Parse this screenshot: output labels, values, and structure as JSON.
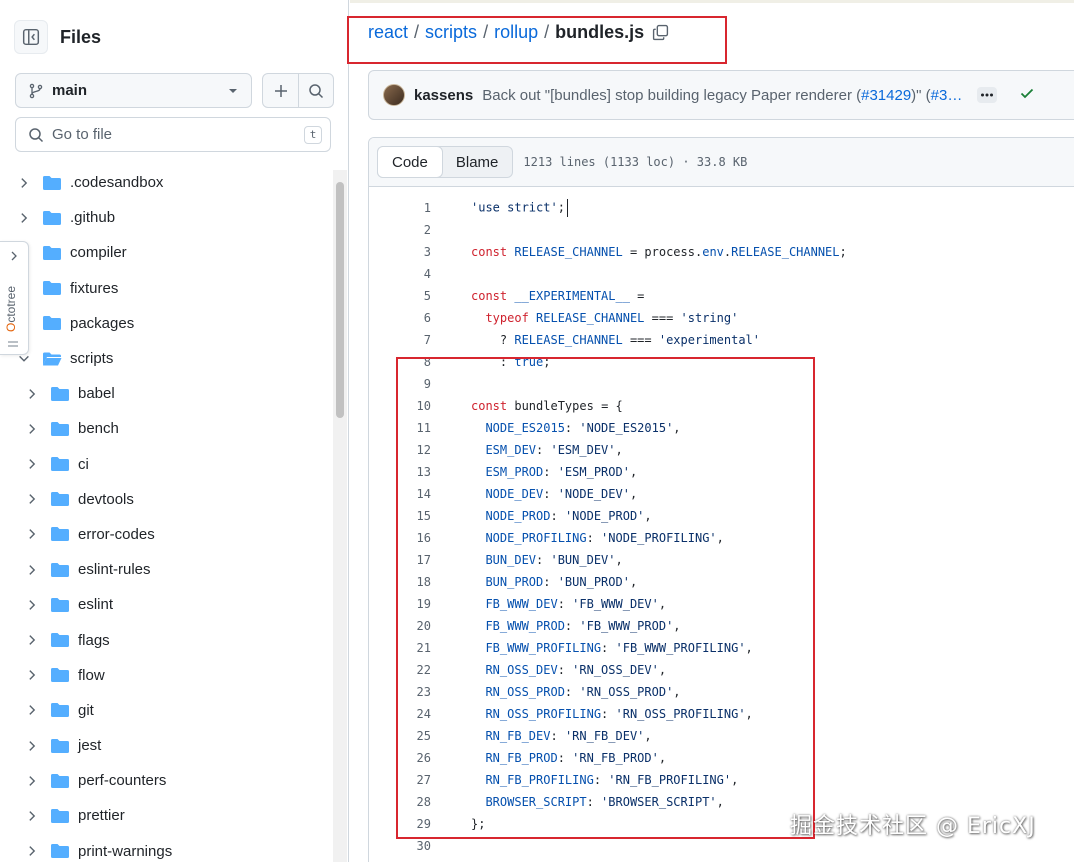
{
  "sidebar": {
    "title": "Files",
    "branch": "main",
    "goto_placeholder": "Go to file",
    "goto_shortcut": "t",
    "octotree_label": "Octotree",
    "tree": [
      {
        "name": ".codesandbox",
        "level": 0,
        "open": false
      },
      {
        "name": ".github",
        "level": 0,
        "open": false
      },
      {
        "name": "compiler",
        "level": 0,
        "open": false
      },
      {
        "name": "fixtures",
        "level": 0,
        "open": false
      },
      {
        "name": "packages",
        "level": 0,
        "open": false
      },
      {
        "name": "scripts",
        "level": 0,
        "open": true
      },
      {
        "name": "babel",
        "level": 1,
        "open": false
      },
      {
        "name": "bench",
        "level": 1,
        "open": false
      },
      {
        "name": "ci",
        "level": 1,
        "open": false
      },
      {
        "name": "devtools",
        "level": 1,
        "open": false
      },
      {
        "name": "error-codes",
        "level": 1,
        "open": false
      },
      {
        "name": "eslint-rules",
        "level": 1,
        "open": false
      },
      {
        "name": "eslint",
        "level": 1,
        "open": false
      },
      {
        "name": "flags",
        "level": 1,
        "open": false
      },
      {
        "name": "flow",
        "level": 1,
        "open": false
      },
      {
        "name": "git",
        "level": 1,
        "open": false
      },
      {
        "name": "jest",
        "level": 1,
        "open": false
      },
      {
        "name": "perf-counters",
        "level": 1,
        "open": false
      },
      {
        "name": "prettier",
        "level": 1,
        "open": false
      },
      {
        "name": "print-warnings",
        "level": 1,
        "open": false
      }
    ]
  },
  "breadcrumb": {
    "parts": [
      "react",
      "scripts",
      "rollup"
    ],
    "file": "bundles.js",
    "separator": "/"
  },
  "commit": {
    "author": "kassens",
    "message_prefix": "Back out \"[bundles] stop building legacy Paper renderer (",
    "pr_link": "#31429",
    "message_suffix": ")\" (",
    "trailing_link": "#3…"
  },
  "code_view": {
    "tabs": [
      "Code",
      "Blame"
    ],
    "active_tab": "Code",
    "file_info": "1213 lines (1133 loc) · 33.8 KB"
  },
  "code_lines": [
    [
      {
        "t": "'use strict'",
        "c": "str"
      },
      {
        "t": ";",
        "c": "plain"
      }
    ],
    [],
    [
      {
        "t": "const ",
        "c": "kw"
      },
      {
        "t": "RELEASE_CHANNEL",
        "c": "id"
      },
      {
        "t": " = process.",
        "c": "plain"
      },
      {
        "t": "env",
        "c": "id"
      },
      {
        "t": ".",
        "c": "plain"
      },
      {
        "t": "RELEASE_CHANNEL",
        "c": "id"
      },
      {
        "t": ";",
        "c": "plain"
      }
    ],
    [],
    [
      {
        "t": "const ",
        "c": "kw"
      },
      {
        "t": "__EXPERIMENTAL__",
        "c": "id"
      },
      {
        "t": " =",
        "c": "plain"
      }
    ],
    [
      {
        "t": "  typeof ",
        "c": "kw"
      },
      {
        "t": "RELEASE_CHANNEL",
        "c": "id"
      },
      {
        "t": " === ",
        "c": "plain"
      },
      {
        "t": "'string'",
        "c": "str"
      }
    ],
    [
      {
        "t": "    ? ",
        "c": "plain"
      },
      {
        "t": "RELEASE_CHANNEL",
        "c": "id"
      },
      {
        "t": " === ",
        "c": "plain"
      },
      {
        "t": "'experimental'",
        "c": "str"
      }
    ],
    [
      {
        "t": "    : ",
        "c": "plain"
      },
      {
        "t": "true",
        "c": "id"
      },
      {
        "t": ";",
        "c": "plain"
      }
    ],
    [],
    [
      {
        "t": "const ",
        "c": "kw"
      },
      {
        "t": "bundleTypes",
        "c": "plain"
      },
      {
        "t": " = {",
        "c": "plain"
      }
    ],
    [
      {
        "t": "  NODE_ES2015",
        "c": "id"
      },
      {
        "t": ": ",
        "c": "plain"
      },
      {
        "t": "'NODE_ES2015'",
        "c": "str"
      },
      {
        "t": ",",
        "c": "plain"
      }
    ],
    [
      {
        "t": "  ESM_DEV",
        "c": "id"
      },
      {
        "t": ": ",
        "c": "plain"
      },
      {
        "t": "'ESM_DEV'",
        "c": "str"
      },
      {
        "t": ",",
        "c": "plain"
      }
    ],
    [
      {
        "t": "  ESM_PROD",
        "c": "id"
      },
      {
        "t": ": ",
        "c": "plain"
      },
      {
        "t": "'ESM_PROD'",
        "c": "str"
      },
      {
        "t": ",",
        "c": "plain"
      }
    ],
    [
      {
        "t": "  NODE_DEV",
        "c": "id"
      },
      {
        "t": ": ",
        "c": "plain"
      },
      {
        "t": "'NODE_DEV'",
        "c": "str"
      },
      {
        "t": ",",
        "c": "plain"
      }
    ],
    [
      {
        "t": "  NODE_PROD",
        "c": "id"
      },
      {
        "t": ": ",
        "c": "plain"
      },
      {
        "t": "'NODE_PROD'",
        "c": "str"
      },
      {
        "t": ",",
        "c": "plain"
      }
    ],
    [
      {
        "t": "  NODE_PROFILING",
        "c": "id"
      },
      {
        "t": ": ",
        "c": "plain"
      },
      {
        "t": "'NODE_PROFILING'",
        "c": "str"
      },
      {
        "t": ",",
        "c": "plain"
      }
    ],
    [
      {
        "t": "  BUN_DEV",
        "c": "id"
      },
      {
        "t": ": ",
        "c": "plain"
      },
      {
        "t": "'BUN_DEV'",
        "c": "str"
      },
      {
        "t": ",",
        "c": "plain"
      }
    ],
    [
      {
        "t": "  BUN_PROD",
        "c": "id"
      },
      {
        "t": ": ",
        "c": "plain"
      },
      {
        "t": "'BUN_PROD'",
        "c": "str"
      },
      {
        "t": ",",
        "c": "plain"
      }
    ],
    [
      {
        "t": "  FB_WWW_DEV",
        "c": "id"
      },
      {
        "t": ": ",
        "c": "plain"
      },
      {
        "t": "'FB_WWW_DEV'",
        "c": "str"
      },
      {
        "t": ",",
        "c": "plain"
      }
    ],
    [
      {
        "t": "  FB_WWW_PROD",
        "c": "id"
      },
      {
        "t": ": ",
        "c": "plain"
      },
      {
        "t": "'FB_WWW_PROD'",
        "c": "str"
      },
      {
        "t": ",",
        "c": "plain"
      }
    ],
    [
      {
        "t": "  FB_WWW_PROFILING",
        "c": "id"
      },
      {
        "t": ": ",
        "c": "plain"
      },
      {
        "t": "'FB_WWW_PROFILING'",
        "c": "str"
      },
      {
        "t": ",",
        "c": "plain"
      }
    ],
    [
      {
        "t": "  RN_OSS_DEV",
        "c": "id"
      },
      {
        "t": ": ",
        "c": "plain"
      },
      {
        "t": "'RN_OSS_DEV'",
        "c": "str"
      },
      {
        "t": ",",
        "c": "plain"
      }
    ],
    [
      {
        "t": "  RN_OSS_PROD",
        "c": "id"
      },
      {
        "t": ": ",
        "c": "plain"
      },
      {
        "t": "'RN_OSS_PROD'",
        "c": "str"
      },
      {
        "t": ",",
        "c": "plain"
      }
    ],
    [
      {
        "t": "  RN_OSS_PROFILING",
        "c": "id"
      },
      {
        "t": ": ",
        "c": "plain"
      },
      {
        "t": "'RN_OSS_PROFILING'",
        "c": "str"
      },
      {
        "t": ",",
        "c": "plain"
      }
    ],
    [
      {
        "t": "  RN_FB_DEV",
        "c": "id"
      },
      {
        "t": ": ",
        "c": "plain"
      },
      {
        "t": "'RN_FB_DEV'",
        "c": "str"
      },
      {
        "t": ",",
        "c": "plain"
      }
    ],
    [
      {
        "t": "  RN_FB_PROD",
        "c": "id"
      },
      {
        "t": ": ",
        "c": "plain"
      },
      {
        "t": "'RN_FB_PROD'",
        "c": "str"
      },
      {
        "t": ",",
        "c": "plain"
      }
    ],
    [
      {
        "t": "  RN_FB_PROFILING",
        "c": "id"
      },
      {
        "t": ": ",
        "c": "plain"
      },
      {
        "t": "'RN_FB_PROFILING'",
        "c": "str"
      },
      {
        "t": ",",
        "c": "plain"
      }
    ],
    [
      {
        "t": "  BROWSER_SCRIPT",
        "c": "id"
      },
      {
        "t": ": ",
        "c": "plain"
      },
      {
        "t": "'BROWSER_SCRIPT'",
        "c": "str"
      },
      {
        "t": ",",
        "c": "plain"
      }
    ],
    [
      {
        "t": "};",
        "c": "plain"
      }
    ],
    []
  ],
  "watermark": "掘金技术社区 @ EricXJ",
  "colors": {
    "accent_link": "#0969da",
    "annotation_red": "#d8262f",
    "folder_blue": "#54aeff",
    "success_green": "#1a7f37"
  }
}
